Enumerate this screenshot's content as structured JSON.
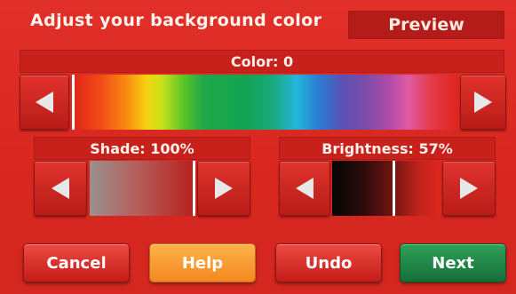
{
  "header": {
    "title": "Adjust your background color",
    "preview_label": "Preview"
  },
  "color": {
    "label": "Color: 0",
    "value": 0
  },
  "shade": {
    "label": "Shade: 100%",
    "value_percent": 100
  },
  "brightness": {
    "label": "Brightness: 57%",
    "value_percent": 57
  },
  "buttons": {
    "cancel": "Cancel",
    "help": "Help",
    "undo": "Undo",
    "next": "Next"
  },
  "icons": {
    "decrease": "left-arrow-icon",
    "increase": "right-arrow-icon"
  },
  "colors": {
    "background": "#d42a24",
    "help_button": "#f59a2b",
    "next_button": "#1b8040",
    "button_red": "#d8302a"
  }
}
